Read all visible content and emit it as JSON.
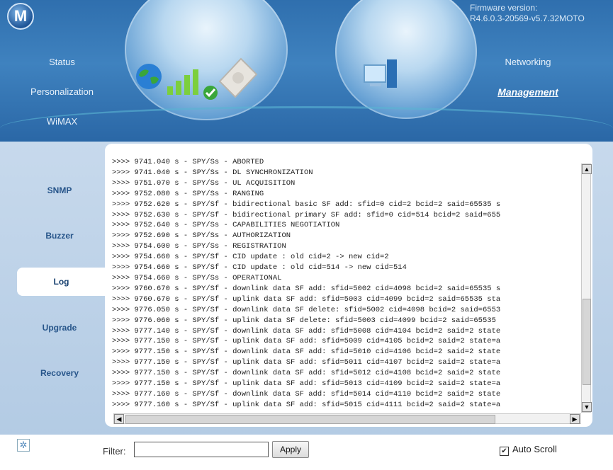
{
  "header": {
    "logo": "M",
    "firmware_label": "Firmware version:",
    "firmware_value": "R4.6.0.3-20569-v5.7.32MOTO",
    "nav_left": [
      "Status",
      "Personalization",
      "WiMAX"
    ],
    "nav_right": [
      "Networking",
      "Management"
    ]
  },
  "sidebar": {
    "items": [
      {
        "label": "SNMP"
      },
      {
        "label": "Buzzer"
      },
      {
        "label": "Log"
      },
      {
        "label": "Upgrade"
      },
      {
        "label": "Recovery"
      }
    ],
    "selected": "Log"
  },
  "log": {
    "lines": [
      ">>>> 9741.040 s - SPY/Ss - ABORTED",
      ">>>> 9741.040 s - SPY/Ss - DL SYNCHRONIZATION",
      ">>>> 9751.070 s - SPY/Ss - UL ACQUISITION",
      ">>>> 9752.080 s - SPY/Ss - RANGING",
      ">>>> 9752.620 s - SPY/Sf - bidirectional basic SF add: sfid=0 cid=2 bcid=2 said=65535 s",
      ">>>> 9752.630 s - SPY/Sf - bidirectional primary SF add: sfid=0 cid=514 bcid=2 said=655",
      ">>>> 9752.640 s - SPY/Ss - CAPABILITIES NEGOTIATION",
      ">>>> 9752.690 s - SPY/Ss - AUTHORIZATION",
      ">>>> 9754.600 s - SPY/Ss - REGISTRATION",
      ">>>> 9754.660 s - SPY/Sf - CID update : old cid=2 -> new cid=2",
      ">>>> 9754.660 s - SPY/Sf - CID update : old cid=514 -> new cid=514",
      ">>>> 9754.660 s - SPY/Ss - OPERATIONAL",
      ">>>> 9760.670 s - SPY/Sf - downlink data SF add: sfid=5002 cid=4098 bcid=2 said=65535 s",
      ">>>> 9760.670 s - SPY/Sf - uplink data SF add: sfid=5003 cid=4099 bcid=2 said=65535 sta",
      ">>>> 9776.050 s - SPY/Sf - downlink data SF delete: sfid=5002 cid=4098 bcid=2 said=6553",
      ">>>> 9776.060 s - SPY/Sf - uplink data SF delete: sfid=5003 cid=4099 bcid=2 said=65535",
      ">>>> 9777.140 s - SPY/Sf - downlink data SF add: sfid=5008 cid=4104 bcid=2 said=2 state",
      ">>>> 9777.150 s - SPY/Sf - uplink data SF add: sfid=5009 cid=4105 bcid=2 said=2 state=a",
      ">>>> 9777.150 s - SPY/Sf - downlink data SF add: sfid=5010 cid=4106 bcid=2 said=2 state",
      ">>>> 9777.150 s - SPY/Sf - uplink data SF add: sfid=5011 cid=4107 bcid=2 said=2 state=a",
      ">>>> 9777.150 s - SPY/Sf - downlink data SF add: sfid=5012 cid=4108 bcid=2 said=2 state",
      ">>>> 9777.150 s - SPY/Sf - uplink data SF add: sfid=5013 cid=4109 bcid=2 said=2 state=a",
      ">>>> 9777.160 s - SPY/Sf - downlink data SF add: sfid=5014 cid=4110 bcid=2 said=2 state",
      ">>>> 9777.160 s - SPY/Sf - uplink data SF add: sfid=5015 cid=4111 bcid=2 said=2 state=a"
    ]
  },
  "bottom": {
    "filter_label": "Filter:",
    "filter_value": "",
    "apply_label": "Apply",
    "auto_scroll_label": "Auto Scroll",
    "auto_scroll_checked": true,
    "checkbox_mark": "✔"
  },
  "icons": {
    "logo": "motorola-logo",
    "globe": "globe-icon",
    "signal": "signal-bars-icon",
    "check": "check-icon",
    "device": "modem-icon",
    "computer": "computer-icon",
    "bottom": "sparkle-icon"
  }
}
